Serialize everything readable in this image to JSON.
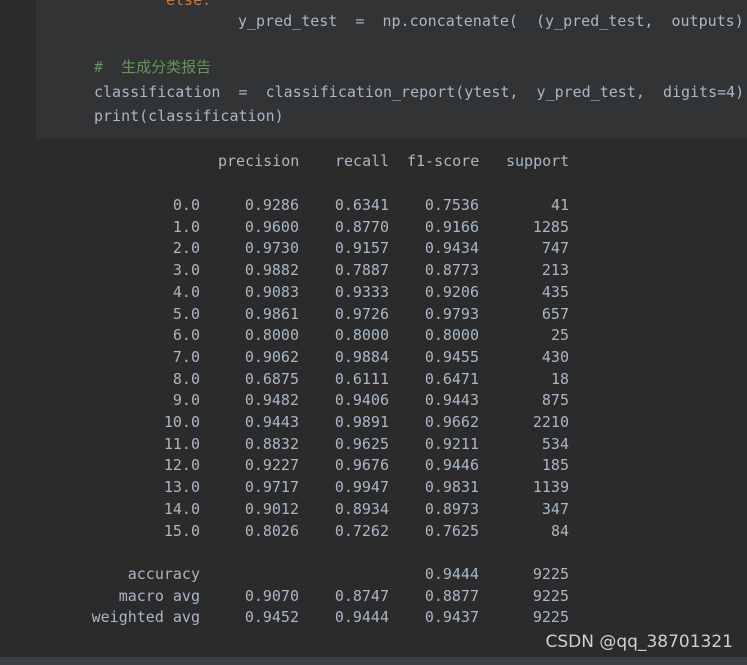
{
  "code": {
    "line0": "else:",
    "line1": "y_pred_test  =  np.concatenate(  (y_pred_test,  outputs)",
    "comment": "#  生成分类报告",
    "line3": "classification  =  classification_report(ytest,  y_pred_test,  digits=4)",
    "line4": "print(classification)"
  },
  "report": {
    "headers": [
      "precision",
      "recall",
      "f1-score",
      "support"
    ],
    "rows": [
      {
        "label": "0.0",
        "precision": "0.9286",
        "recall": "0.6341",
        "f1": "0.7536",
        "support": "41"
      },
      {
        "label": "1.0",
        "precision": "0.9600",
        "recall": "0.8770",
        "f1": "0.9166",
        "support": "1285"
      },
      {
        "label": "2.0",
        "precision": "0.9730",
        "recall": "0.9157",
        "f1": "0.9434",
        "support": "747"
      },
      {
        "label": "3.0",
        "precision": "0.9882",
        "recall": "0.7887",
        "f1": "0.8773",
        "support": "213"
      },
      {
        "label": "4.0",
        "precision": "0.9083",
        "recall": "0.9333",
        "f1": "0.9206",
        "support": "435"
      },
      {
        "label": "5.0",
        "precision": "0.9861",
        "recall": "0.9726",
        "f1": "0.9793",
        "support": "657"
      },
      {
        "label": "6.0",
        "precision": "0.8000",
        "recall": "0.8000",
        "f1": "0.8000",
        "support": "25"
      },
      {
        "label": "7.0",
        "precision": "0.9062",
        "recall": "0.9884",
        "f1": "0.9455",
        "support": "430"
      },
      {
        "label": "8.0",
        "precision": "0.6875",
        "recall": "0.6111",
        "f1": "0.6471",
        "support": "18"
      },
      {
        "label": "9.0",
        "precision": "0.9482",
        "recall": "0.9406",
        "f1": "0.9443",
        "support": "875"
      },
      {
        "label": "10.0",
        "precision": "0.9443",
        "recall": "0.9891",
        "f1": "0.9662",
        "support": "2210"
      },
      {
        "label": "11.0",
        "precision": "0.8832",
        "recall": "0.9625",
        "f1": "0.9211",
        "support": "534"
      },
      {
        "label": "12.0",
        "precision": "0.9227",
        "recall": "0.9676",
        "f1": "0.9446",
        "support": "185"
      },
      {
        "label": "13.0",
        "precision": "0.9717",
        "recall": "0.9947",
        "f1": "0.9831",
        "support": "1139"
      },
      {
        "label": "14.0",
        "precision": "0.9012",
        "recall": "0.8934",
        "f1": "0.8973",
        "support": "347"
      },
      {
        "label": "15.0",
        "precision": "0.8026",
        "recall": "0.7262",
        "f1": "0.7625",
        "support": "84"
      }
    ],
    "summary": [
      {
        "label": "accuracy",
        "precision": "",
        "recall": "",
        "f1": "0.9444",
        "support": "9225"
      },
      {
        "label": "macro avg",
        "precision": "0.9070",
        "recall": "0.8747",
        "f1": "0.8877",
        "support": "9225"
      },
      {
        "label": "weighted avg",
        "precision": "0.9452",
        "recall": "0.9444",
        "f1": "0.9437",
        "support": "9225"
      }
    ]
  },
  "watermark": "CSDN @qq_38701321",
  "colors": {
    "background": "#2b2b2b",
    "code_background": "#313335",
    "text": "#a9b7c6",
    "keyword": "#cc7832",
    "comment": "#629755"
  }
}
